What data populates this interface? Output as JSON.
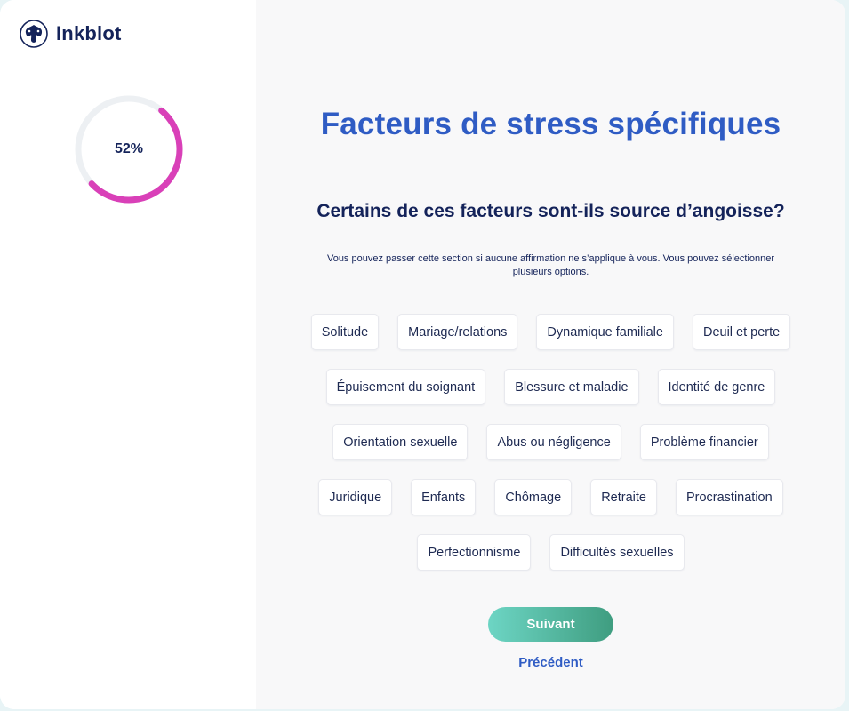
{
  "brand": {
    "name": "Inkblot"
  },
  "progress": {
    "label": "52%",
    "value": 0.52,
    "color": "#d940b8"
  },
  "main": {
    "title": "Facteurs de stress spécifiques",
    "question": "Certains de ces facteurs sont-ils source d’angoisse?",
    "hint": "Vous pouvez passer cette section si aucune affirmation ne s’applique à vous. Vous pouvez sélectionner plusieurs options.",
    "options": [
      "Solitude",
      "Mariage/relations",
      "Dynamique familiale",
      "Deuil et perte",
      "Épuisement du soignant",
      "Blessure et maladie",
      "Identité de genre",
      "Orientation sexuelle",
      "Abus ou négligence",
      "Problème financier",
      "Juridique",
      "Enfants",
      "Chômage",
      "Retraite",
      "Procrastination",
      "Perfectionnisme",
      "Difficultés sexuelles"
    ],
    "next_label": "Suivant",
    "prev_label": "Précédent"
  },
  "colors": {
    "title": "#2f5cc4",
    "text": "#14235a",
    "button_start": "#6dd5c4",
    "button_end": "#3f9d80"
  }
}
